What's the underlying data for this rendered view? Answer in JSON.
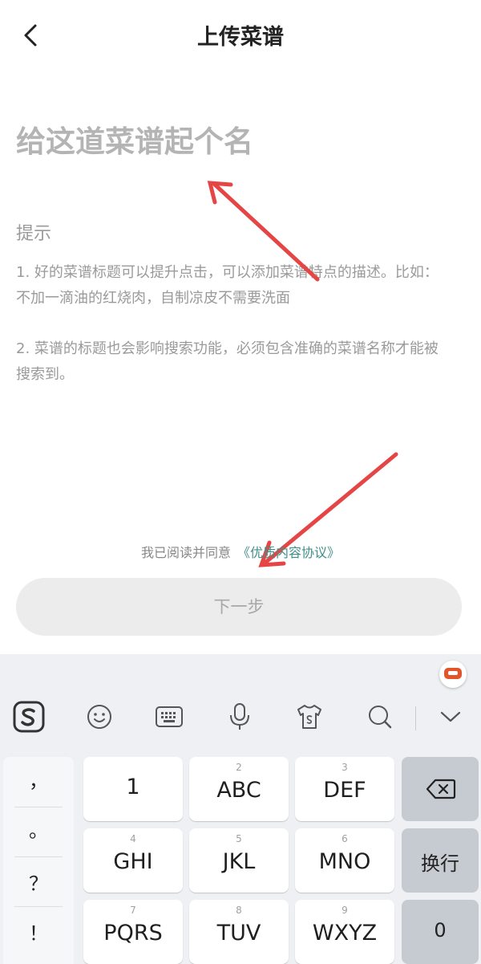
{
  "header": {
    "back_icon": "chevron-left-icon",
    "title": "上传菜谱"
  },
  "form": {
    "name_placeholder": "给这道菜谱起个名",
    "tips_heading": "提示",
    "tip1": "1. 好的菜谱标题可以提升点击，可以添加菜谱特点的描述。比如：不加一滴油的红烧肉，自制凉皮不需要洗面",
    "tip2": "2. 菜谱的标题也会影响搜索功能，必须包含准确的菜谱名称才能被搜索到。"
  },
  "agreement": {
    "text": "我已阅读并同意",
    "link": "《优质内容协议》"
  },
  "next_button": "下一步",
  "keyboard": {
    "toolbar": [
      "sogou-logo-icon",
      "emoji-icon",
      "keyboard-icon",
      "microphone-icon",
      "skin-icon",
      "search-icon",
      "chevron-down-icon"
    ],
    "punctuation": [
      "，",
      "。",
      "？",
      "！"
    ],
    "keys": [
      {
        "num": "",
        "label": "1"
      },
      {
        "num": "2",
        "label": "ABC"
      },
      {
        "num": "3",
        "label": "DEF"
      },
      {
        "num": "4",
        "label": "GHI"
      },
      {
        "num": "5",
        "label": "JKL"
      },
      {
        "num": "6",
        "label": "MNO"
      },
      {
        "num": "7",
        "label": "PQRS"
      },
      {
        "num": "8",
        "label": "TUV"
      },
      {
        "num": "9",
        "label": "WXYZ"
      }
    ],
    "function_keys": {
      "backspace_icon": "backspace-icon",
      "newline": "换行",
      "zero": "0"
    }
  }
}
